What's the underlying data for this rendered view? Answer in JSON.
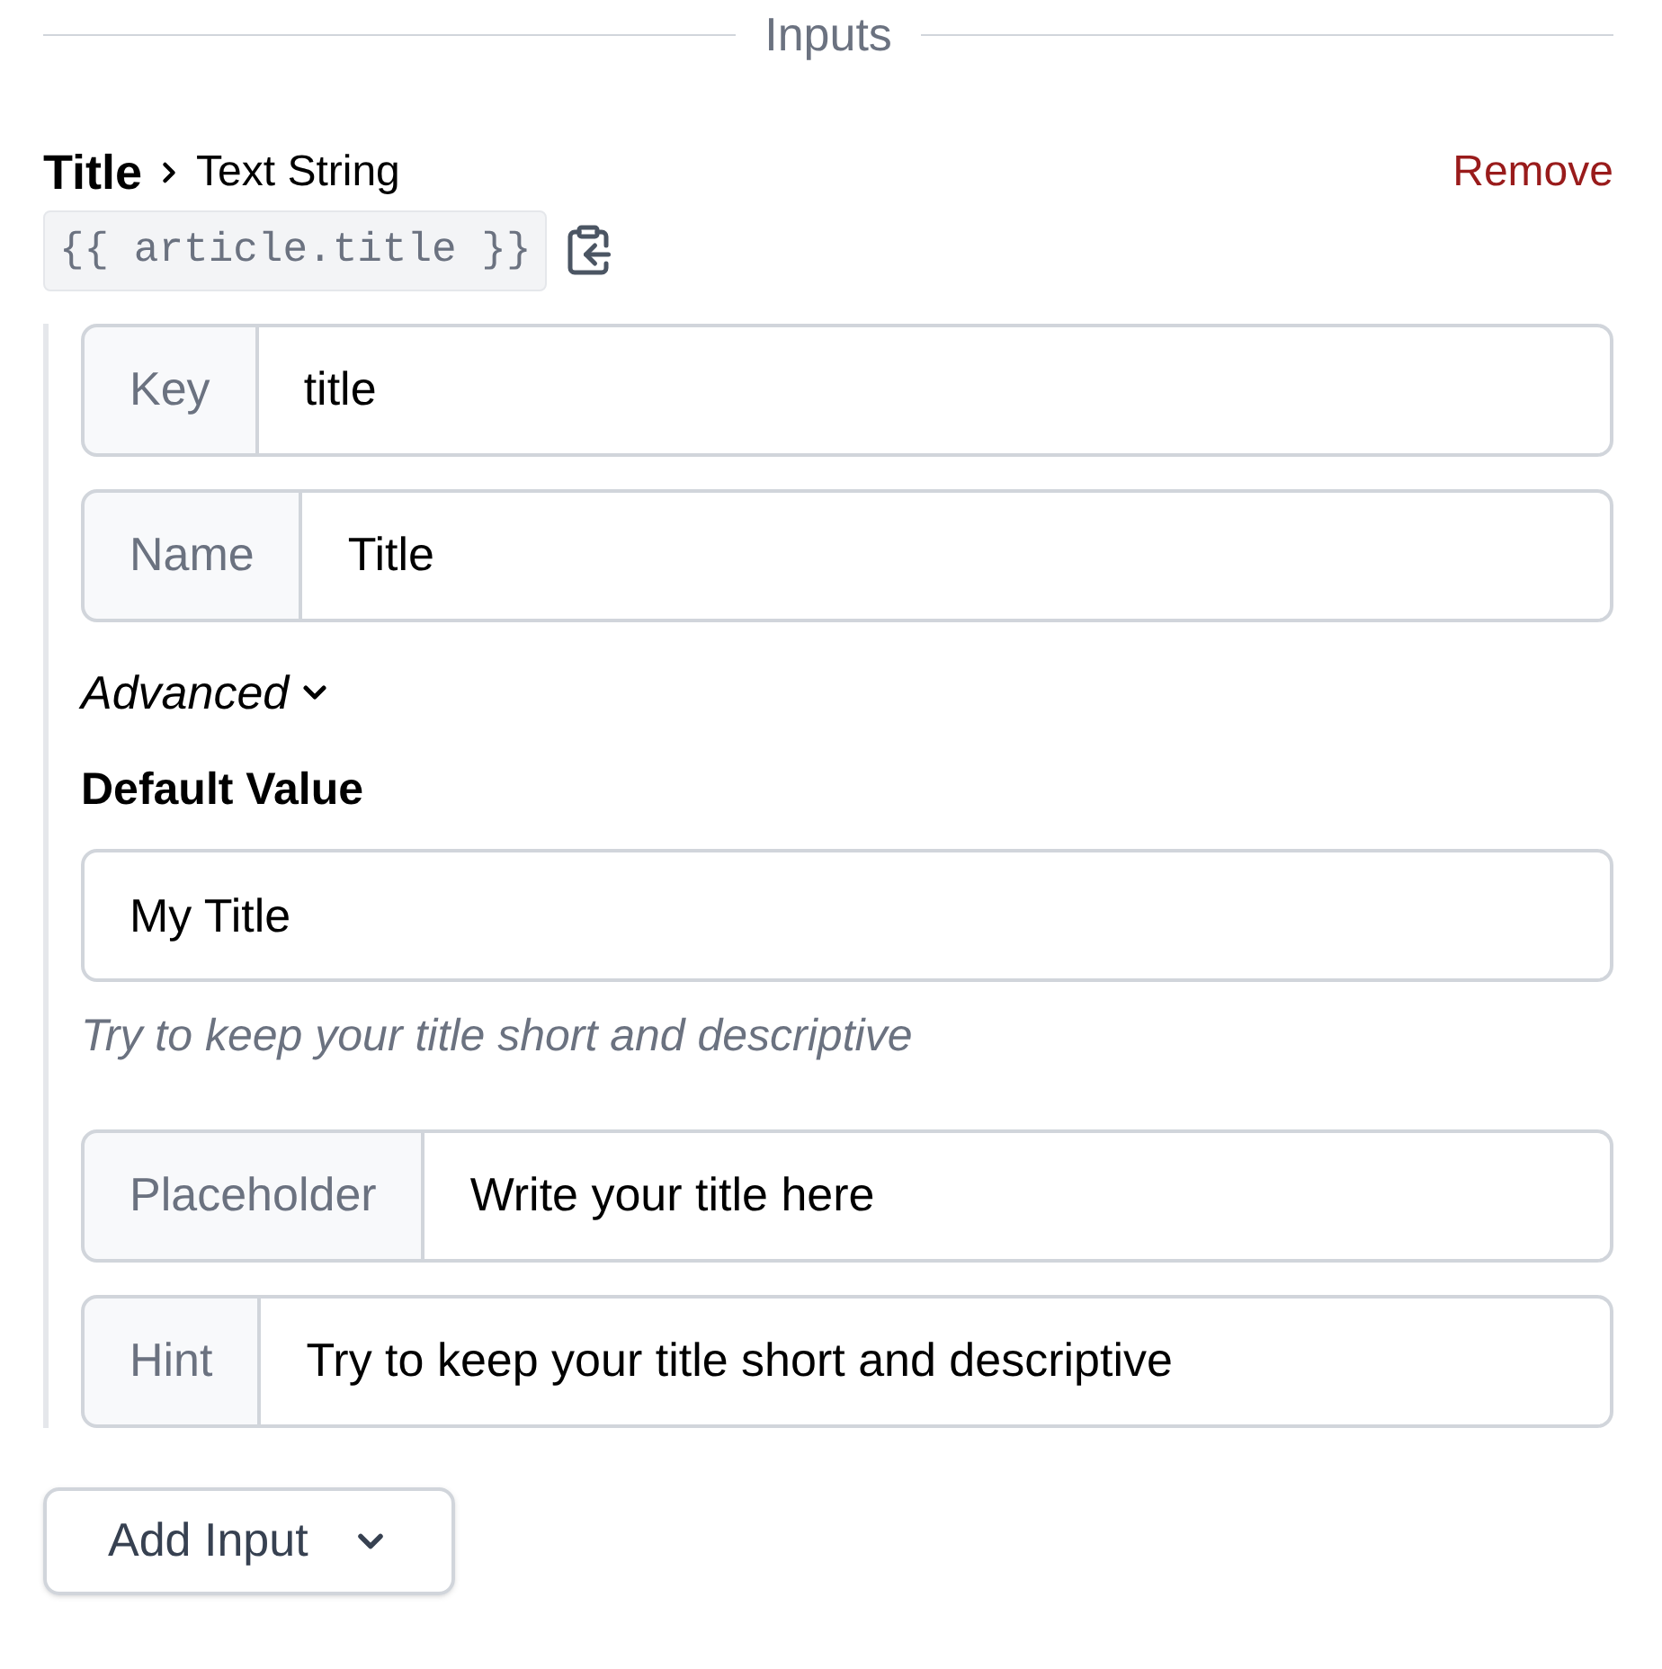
{
  "section_title": "Inputs",
  "inputs": [
    {
      "title": "Title",
      "type": "Text String",
      "variable": "{{ article.title }}",
      "remove": "Remove",
      "fields": [
        {
          "label": "Key",
          "value": "title"
        },
        {
          "label": "Name",
          "value": "Title"
        }
      ],
      "advanced": {
        "label": "Advanced",
        "expanded": true
      },
      "default_value": {
        "label": "Default Value",
        "value": "My Title",
        "hint": "Try to keep your title short and descriptive"
      },
      "advanced_fields": [
        {
          "label": "Placeholder",
          "value": "Write your title here"
        },
        {
          "label": "Hint",
          "value": "Try to keep your title short and descriptive"
        }
      ]
    }
  ],
  "add_button": "Add Input"
}
